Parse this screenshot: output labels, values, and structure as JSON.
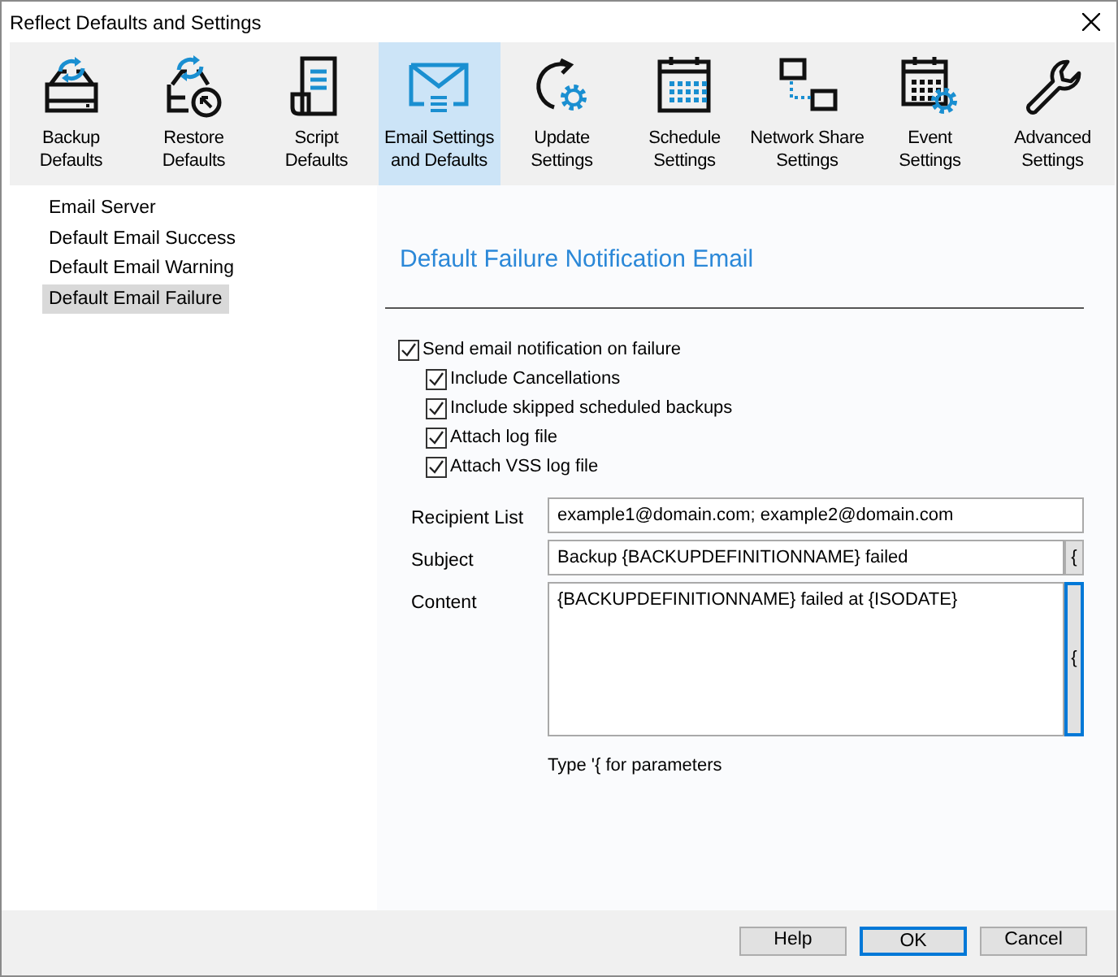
{
  "window": {
    "title": "Reflect Defaults and Settings"
  },
  "toolbar": [
    {
      "kind": "backup",
      "label": "Backup\nDefaults",
      "selected": false
    },
    {
      "kind": "restore",
      "label": "Restore\nDefaults",
      "selected": false
    },
    {
      "kind": "script",
      "label": "Script\nDefaults",
      "selected": false
    },
    {
      "kind": "email",
      "label": "Email Settings\nand Defaults",
      "selected": true
    },
    {
      "kind": "update",
      "label": "Update\nSettings",
      "selected": false
    },
    {
      "kind": "schedule",
      "label": "Schedule\nSettings",
      "selected": false
    },
    {
      "kind": "network",
      "label": "Network Share\nSettings",
      "selected": false
    },
    {
      "kind": "event",
      "label": "Event\nSettings",
      "selected": false
    },
    {
      "kind": "advanced",
      "label": "Advanced\nSettings",
      "selected": false
    }
  ],
  "sidebar": {
    "items": [
      {
        "label": "Email Server",
        "selected": false
      },
      {
        "label": "Default Email Success",
        "selected": false
      },
      {
        "label": "Default Email Warning",
        "selected": false
      },
      {
        "label": "Default Email Failure",
        "selected": true
      }
    ]
  },
  "panel": {
    "title": "Default Failure Notification Email",
    "options": [
      {
        "label": "Send email notification on failure",
        "checked": true,
        "children": [
          {
            "label": "Include Cancellations",
            "checked": true
          },
          {
            "label": "Include skipped scheduled backups",
            "checked": true
          },
          {
            "label": "Attach log file",
            "checked": true
          },
          {
            "label": "Attach VSS log file",
            "checked": true
          }
        ]
      }
    ],
    "fields": [
      {
        "kind": "line",
        "label": "Recipient List",
        "value": "example1@domain.com; example2@domain.com"
      },
      {
        "kind": "line",
        "label": "Subject",
        "value": "Backup {BACKUPDEFINITIONNAME} failed",
        "param_button": "{"
      },
      {
        "kind": "area",
        "label": "Content",
        "value": "{BACKUPDEFINITIONNAME} failed at {ISODATE}",
        "param_button": "{"
      }
    ],
    "hint": "Type '{ for parameters"
  },
  "buttons": [
    {
      "label": "Help",
      "default": false
    },
    {
      "label": "OK",
      "default": true
    },
    {
      "label": "Cancel",
      "default": false
    }
  ]
}
